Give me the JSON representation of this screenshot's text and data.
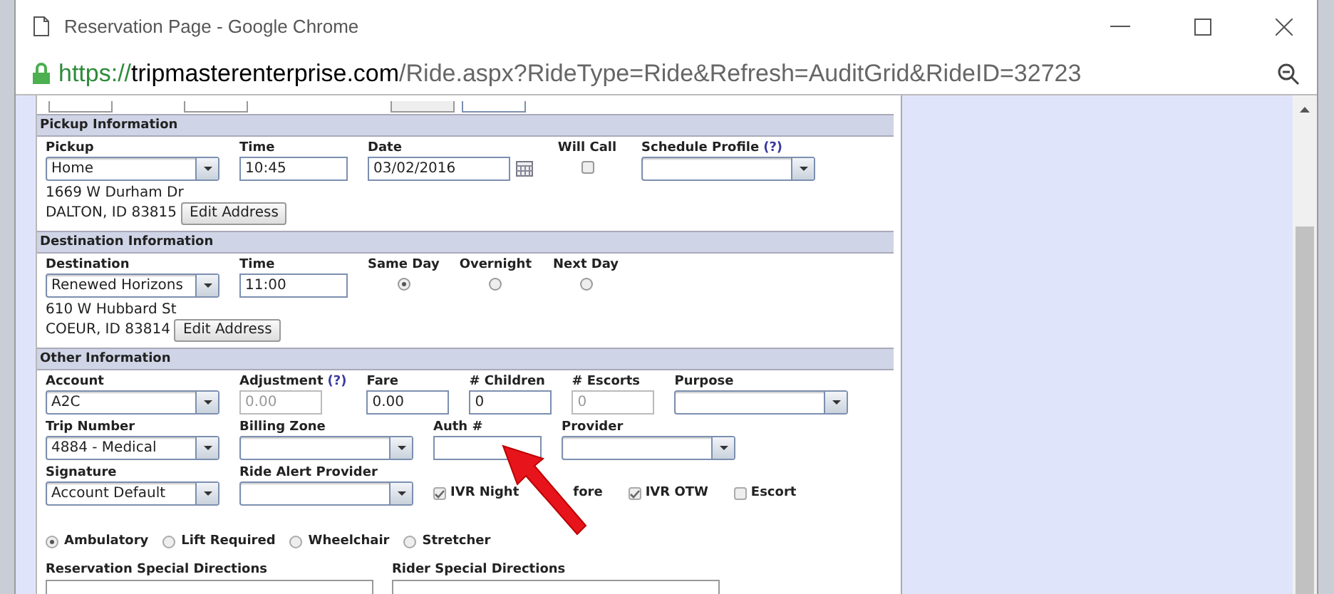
{
  "window": {
    "title": "Reservation Page - Google Chrome",
    "url_scheme": "https://",
    "url_host": "tripmasterenterprise.com",
    "url_path": "/Ride.aspx?RideType=Ride&Refresh=AuditGrid&RideID=32723"
  },
  "sections": [
    {
      "title": "Pickup Information",
      "rows": [
        [
          {
            "kind": "select",
            "label": "Pickup",
            "value": "Home"
          },
          {
            "kind": "text",
            "label": "Time",
            "value": "10:45"
          },
          {
            "kind": "date",
            "label": "Date",
            "value": "03/02/2016"
          },
          {
            "kind": "checkbox",
            "label": "Will Call",
            "checked": false
          },
          {
            "kind": "select",
            "label": "Schedule Profile",
            "help": "(?)"
          }
        ]
      ],
      "address": {
        "lines": [
          "1669 W Durham Dr",
          "DALTON, ID 83815"
        ],
        "button": "Edit Address"
      }
    },
    {
      "title": "Destination Information",
      "rows": [
        [
          {
            "kind": "select",
            "label": "Destination",
            "value": "Renewed Horizons"
          },
          {
            "kind": "text",
            "label": "Time",
            "value": "11:00"
          },
          {
            "kind": "radio",
            "label": "Same Day",
            "selected": true
          },
          {
            "kind": "radio",
            "label": "Overnight",
            "selected": false
          },
          {
            "kind": "radio",
            "label": "Next Day",
            "selected": false
          }
        ]
      ],
      "address": {
        "lines": [
          "610 W Hubbard St",
          "COEUR, ID 83814"
        ],
        "button": "Edit Address"
      }
    },
    {
      "title": "Other Information",
      "rows": [
        [
          {
            "kind": "select",
            "label": "Account",
            "value": "A2C"
          },
          {
            "kind": "number",
            "label": "Adjustment",
            "help": "(?)",
            "value": "0.00",
            "disabled": true
          },
          {
            "kind": "number",
            "label": "Fare",
            "value": "0.00",
            "disabled": false
          },
          {
            "kind": "number",
            "label": "# Children",
            "value": "0",
            "disabled": false
          },
          {
            "kind": "number",
            "label": "# Escorts",
            "value": "0",
            "disabled": true
          },
          {
            "kind": "select",
            "label": "Purpose"
          }
        ],
        [
          {
            "kind": "select",
            "label": "Trip Number",
            "value": "4884 - Medical"
          },
          {
            "kind": "select",
            "label": "Billing Zone"
          },
          {
            "kind": "text",
            "label": "Auth #"
          },
          {
            "kind": "select",
            "label": "Provider"
          }
        ],
        [
          {
            "kind": "select",
            "label": "Signature",
            "value": "Account Default"
          },
          {
            "kind": "select",
            "label": "Ride Alert Provider"
          },
          {
            "kind": "inline_checkbox",
            "label": "IVR Night",
            "label_tail": "fore",
            "checked": true
          },
          {
            "kind": "inline_checkbox",
            "label": "IVR OTW",
            "checked": true
          },
          {
            "kind": "inline_checkbox",
            "label": "Escort",
            "checked": false
          }
        ]
      ],
      "mobility": [
        {
          "label": "Ambulatory",
          "selected": true
        },
        {
          "label": "Lift Required",
          "selected": false
        },
        {
          "label": "Wheelchair",
          "selected": false
        },
        {
          "label": "Stretcher",
          "selected": false
        }
      ],
      "directions": [
        "Reservation Special Directions",
        "Rider Special Directions"
      ]
    }
  ]
}
